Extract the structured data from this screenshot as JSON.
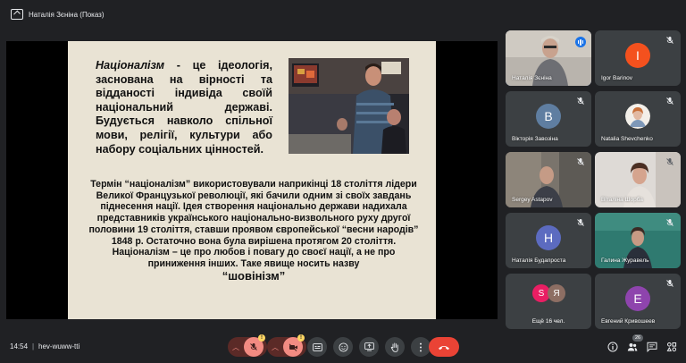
{
  "window": {
    "title": "Наталія Зєніна (Показ)"
  },
  "slide": {
    "definition_term": "Націоналізм",
    "definition_rest": " - це ідеологія, заснована на вірності та відданості індивіда своїй національний державі. Будується навколо спільної мови, релігії, культури або набору соціальних цінностей.",
    "body": "Термін “націоналізм” використовували наприкінці 18 століття лідери Великої Французької революції, які бачили одним зі своїх завдань піднесення нації. Ідея створення національно держави надихала представників українського національно-визвольного руху другої половини 19 століття, ставши проявом європейської “весни народів” 1848 р. Остаточно вона була вирішена протягом 20 століття. Націоналізм – це про любов і повагу до своєї нації, а не про приниження інших. Таке явище носить назву",
    "chauvinism": "“шовінізм”"
  },
  "participants": [
    {
      "name": "Наталія Зєніна",
      "type": "video",
      "speaking": true
    },
    {
      "name": "Igor Barinov",
      "type": "avatar",
      "initial": "I",
      "color": "#f4511e",
      "muted": true
    },
    {
      "name": "Вікторія Завозіна",
      "type": "avatar",
      "initial": "В",
      "color": "#5f7ea1",
      "muted": true
    },
    {
      "name": "Natalia Shevchenko",
      "type": "photo",
      "muted": true
    },
    {
      "name": "Sergey Astapov",
      "type": "video",
      "muted": true
    },
    {
      "name": "Віталіна Шорба",
      "type": "video",
      "muted": true
    },
    {
      "name": "Наталія Будапроста",
      "type": "avatar",
      "initial": "Н",
      "color": "#5c6bc0",
      "muted": true
    },
    {
      "name": "Галина Журавель",
      "type": "video",
      "muted": true
    },
    {
      "name": "Ещё 16 чел.",
      "type": "more",
      "initials": [
        "S",
        "Я"
      ],
      "colors": [
        "#e91e63",
        "#8d6e63"
      ]
    },
    {
      "name": "Евгений Кривошеев",
      "type": "avatar",
      "initial": "E",
      "color": "#8e44ad",
      "muted": true
    }
  ],
  "bottombar": {
    "time": "14:54",
    "separator": "|",
    "meeting_code": "hev-wuww-tti",
    "mic_warning": "!",
    "cam_warning": "!",
    "people_count": "26"
  },
  "colors": {
    "background": "#202124",
    "tile": "#3c4043",
    "accent": "#8ab4f8",
    "hangup": "#ea4335",
    "muted_control": "#f28b82"
  },
  "icons": [
    "present-icon",
    "mic-off-icon",
    "camera-off-icon",
    "captions-icon",
    "emoji-icon",
    "present-screen-icon",
    "raise-hand-icon",
    "more-options-icon",
    "hangup-icon",
    "info-icon",
    "people-icon",
    "chat-icon",
    "activities-icon"
  ]
}
